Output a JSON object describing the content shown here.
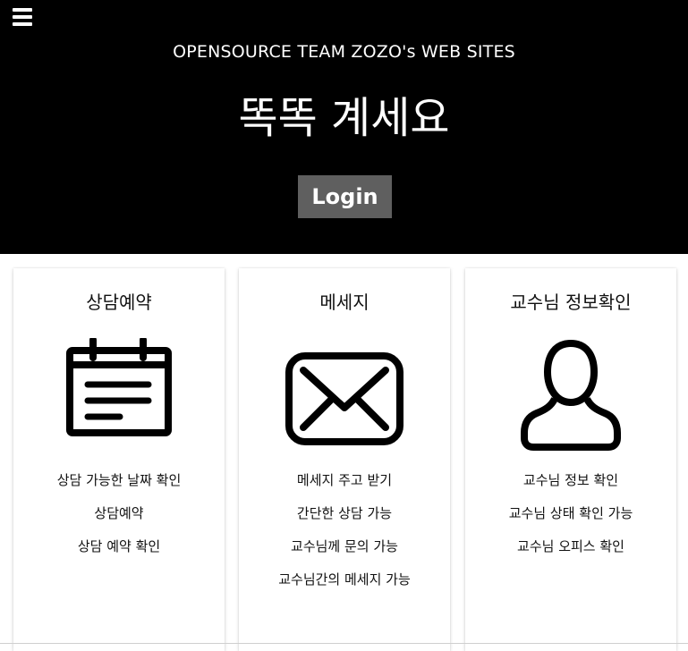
{
  "header": {
    "subtitle": "OPENSOURCE TEAM ZOZO's WEB SITES",
    "title": "똑똑 계세요",
    "login_label": "Login",
    "background": "#000000",
    "login_bg": "#5f5f5f"
  },
  "cards": [
    {
      "title": "상담예약",
      "icon": "calendar-icon",
      "items": [
        "상담 가능한 날짜 확인",
        "상담예약",
        "상담 예약 확인"
      ]
    },
    {
      "title": "메세지",
      "icon": "envelope-icon",
      "items": [
        "메세지 주고 받기",
        "간단한 상담 가능",
        "교수님께 문의 가능",
        "교수님간의 메세지 가능"
      ]
    },
    {
      "title": "교수님 정보확인",
      "icon": "user-icon",
      "items": [
        "교수님 정보 확인",
        "교수님 상태 확인 가능",
        "교수님 오피스 확인"
      ]
    }
  ]
}
